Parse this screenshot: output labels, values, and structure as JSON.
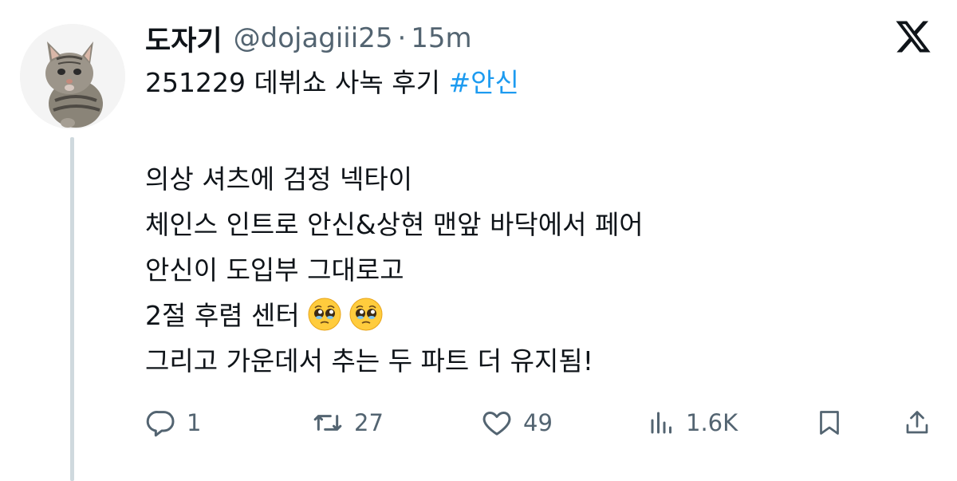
{
  "author": {
    "display_name": "도자기",
    "handle": "@dojagiii25",
    "separator": "·",
    "time": "15m"
  },
  "tweet": {
    "first_line_text": "251229 데뷔쇼 사녹 후기 ",
    "hashtag": "#안신",
    "lines": [
      "의상 셔츠에 검정 넥타이",
      "체인스 인트로 안신&상현 맨앞 바닥에서 페어",
      "안신이 도입부 그대로고",
      "2절 후렴 센터",
      "그리고 가운데서 추는 두 파트 더 유지됨!"
    ],
    "emoji": [
      "pleading-face",
      "pleading-face"
    ]
  },
  "actions": {
    "replies": "1",
    "reposts": "27",
    "likes": "49",
    "views": "1.6K"
  },
  "colors": {
    "text": "#0f1419",
    "secondary": "#536471",
    "accent": "#1d9bf0",
    "thread_line": "#cfd9de"
  },
  "icons": [
    "x-logo-icon",
    "reply-icon",
    "repost-icon",
    "like-icon",
    "views-icon",
    "bookmark-icon",
    "share-icon"
  ]
}
